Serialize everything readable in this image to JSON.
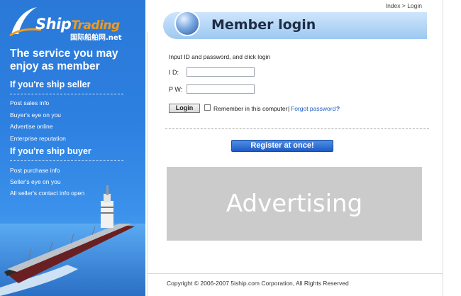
{
  "logo": {
    "brand_ship": "Ship",
    "brand_trading": "Trading",
    "sub_text": "国际船舶网.net"
  },
  "sidebar": {
    "tagline": "The service you may enjoy as member",
    "seller_heading": "If you're ship seller",
    "seller_links": [
      "Post sales info",
      "Buyer's eye on you",
      "Advertise online",
      "Enterprise reputation"
    ],
    "buyer_heading": "If you're ship buyer",
    "buyer_links": [
      "Post purchase info",
      "Seller's eye on you",
      "All seller's contact info open"
    ]
  },
  "breadcrumb": "Index > Login",
  "header": {
    "title": "Member login"
  },
  "form": {
    "instruction": "Input ID and password, and click login",
    "id_label": "I D:",
    "pw_label": "P W:",
    "id_value": "",
    "pw_value": "",
    "login_label": "Login",
    "remember_label": "Remember in this computer",
    "separator": "|",
    "forgot_label": "Forgot password",
    "help_icon": "?",
    "remember_checked": false
  },
  "register": {
    "label": "Register at once!"
  },
  "ad": {
    "text": "Advertising"
  },
  "footer": {
    "copyright": "Copyright © 2006-2007 5iship.com Corporation, All Rights Reserved"
  },
  "colors": {
    "sidebar_blue": "#2d7fe0",
    "accent_orange": "#f39a1a",
    "link_blue": "#1f5cc4",
    "register_blue": "#1f5bc4",
    "ad_gray": "#cbcbcb"
  }
}
